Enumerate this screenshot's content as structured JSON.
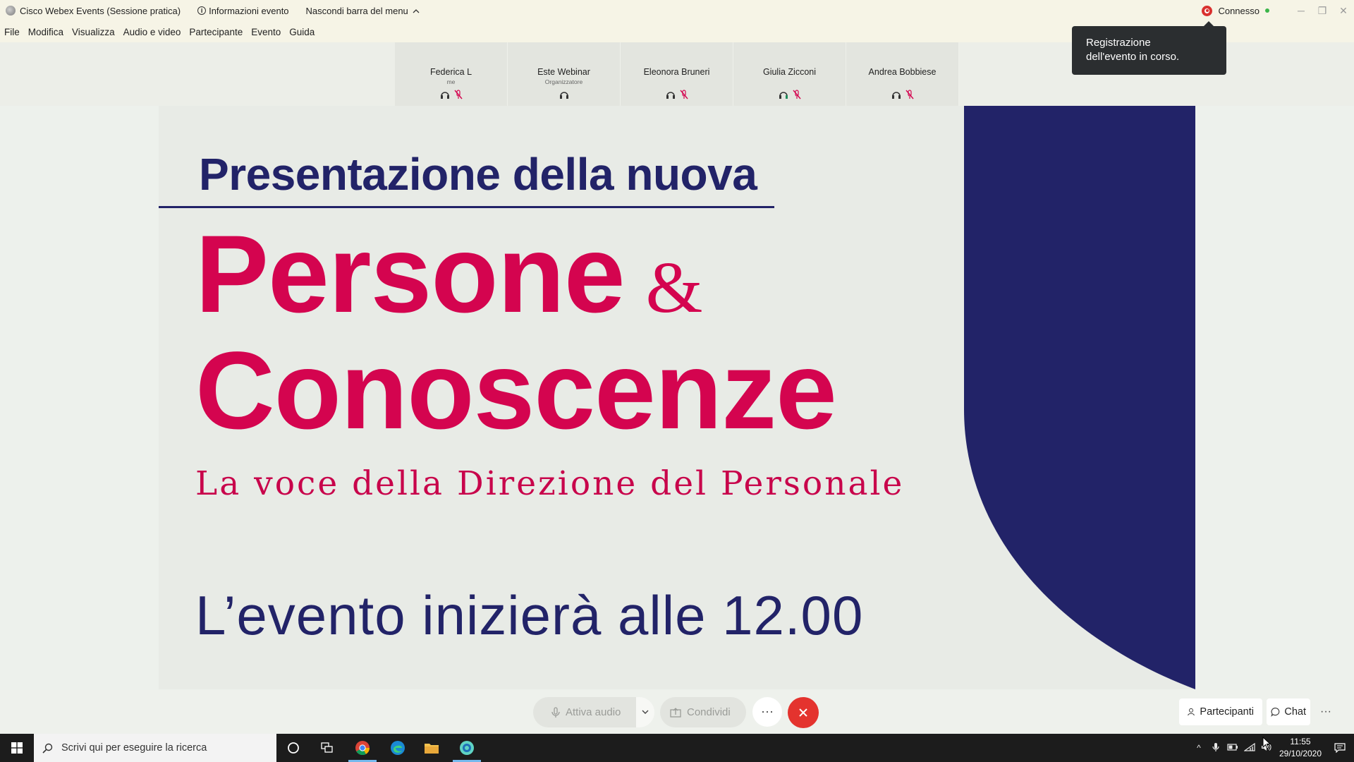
{
  "titlebar": {
    "app_title": "Cisco Webex Events (Sessione pratica)",
    "event_info": "Informazioni evento",
    "hide_menu": "Nascondi barra del menu",
    "status": "Connesso",
    "status_color": "#3bb54a"
  },
  "menu": [
    "File",
    "Modifica",
    "Visualizza",
    "Audio e video",
    "Partecipante",
    "Evento",
    "Guida"
  ],
  "participants": [
    {
      "name": "Federica L",
      "role": "me",
      "muted": true
    },
    {
      "name": "Este Webinar",
      "role": "Organizzatore",
      "muted": false
    },
    {
      "name": "Eleonora Bruneri",
      "role": "",
      "muted": true
    },
    {
      "name": "Giulia Zicconi",
      "role": "",
      "muted": true
    },
    {
      "name": "Andrea Bobbiese",
      "role": "",
      "muted": true
    }
  ],
  "tooltip": {
    "line1": "Registrazione",
    "line2": "dell'evento in corso."
  },
  "slide": {
    "heading": "Presentazione della nuova",
    "title_line1": "Persone",
    "ampersand": "&",
    "title_line2": "Conoscenze",
    "subtitle": "La voce della Direzione del Personale",
    "start_time": "L’evento inizierà alle 12.00",
    "navy": "#222368",
    "magenta": "#d4044f"
  },
  "controls": {
    "audio": "Attiva audio",
    "share": "Condividi",
    "more": "···",
    "participants": "Partecipanti",
    "chat": "Chat",
    "end_color": "#e4332e"
  },
  "taskbar": {
    "search_placeholder": "Scrivi qui per eseguire la ricerca",
    "time": "11:55",
    "date": "29/10/2020"
  }
}
